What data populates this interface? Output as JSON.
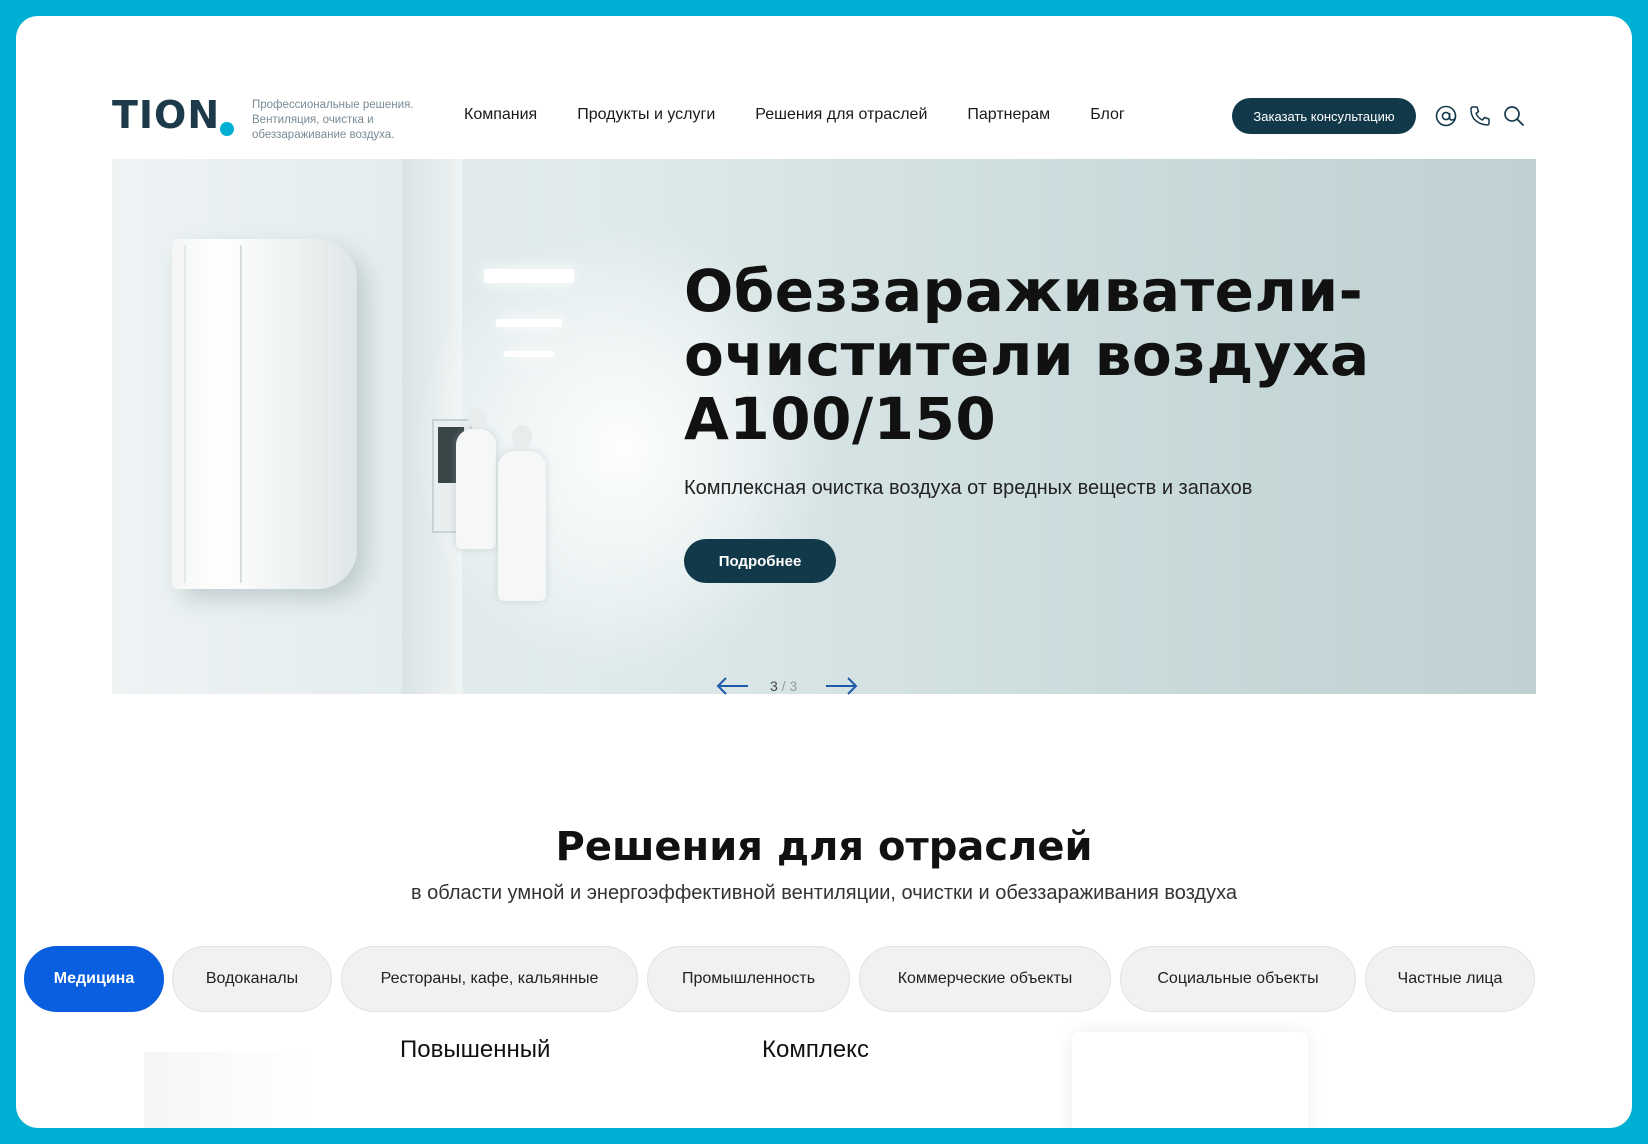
{
  "brand": {
    "logo": "TION",
    "tagline": "Профессиональные решения. Вентиляция, очистка и обеззараживание воздуха."
  },
  "nav": {
    "items": [
      "Компания",
      "Продукты и услуги",
      "Решения для отраслей",
      "Партнерам",
      "Блог"
    ],
    "cta": "Заказать консультацию",
    "icons": [
      "email-icon",
      "phone-icon",
      "search-icon"
    ]
  },
  "hero": {
    "title": "Обеззараживатели-\nочистители воздуха\nА100/150",
    "subtitle": "Комплексная очистка воздуха от вредных веществ и запахов",
    "button": "Подробнее"
  },
  "pager": {
    "current": "3",
    "separator": " / ",
    "total": "3"
  },
  "section": {
    "title": "Решения для отраслей",
    "subtitle": "в области умной и энергоэффективной вентиляции, очистки и обеззараживания воздуха"
  },
  "tabs": [
    {
      "label": "Медицина",
      "active": true
    },
    {
      "label": "Водоканалы",
      "active": false
    },
    {
      "label": "Рестораны, кафе, кальянные",
      "active": false
    },
    {
      "label": "Промышленность",
      "active": false
    },
    {
      "label": "Коммерческие объекты",
      "active": false
    },
    {
      "label": "Социальные объекты",
      "active": false
    },
    {
      "label": "Частные лица",
      "active": false
    }
  ],
  "cards": [
    "Повышенный",
    "Комплекс"
  ],
  "colors": {
    "frame": "#00b0d4",
    "primary_dark": "#12394a",
    "active_tab": "#0a5ee0",
    "arrow": "#1d5aa8"
  }
}
